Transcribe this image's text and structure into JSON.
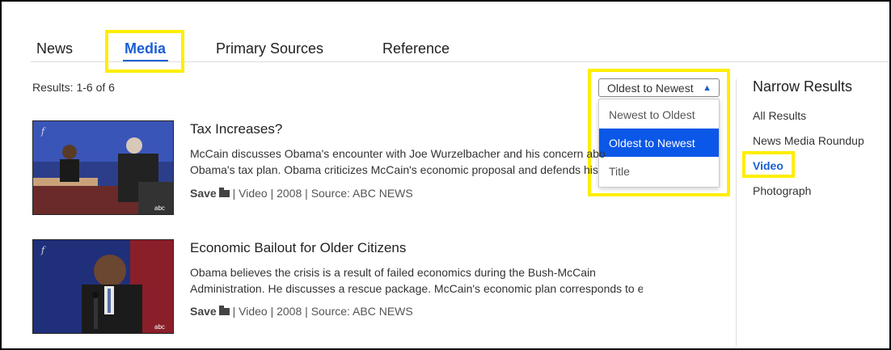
{
  "tabs": [
    {
      "label": "News"
    },
    {
      "label": "Media"
    },
    {
      "label": "Primary Sources"
    },
    {
      "label": "Reference"
    }
  ],
  "results_count": "Results: 1-6 of 6",
  "sort": {
    "selected": "Oldest to Newest",
    "options": [
      "Newest to Oldest",
      "Oldest to Newest",
      "Title"
    ]
  },
  "narrow": {
    "title": "Narrow Results",
    "facets": [
      "All Results",
      "News Media Roundup",
      "Video",
      "Photograph"
    ],
    "active": "Video"
  },
  "results": [
    {
      "title": "Tax Increases?",
      "desc_lines": [
        "McCain discusses Obama's encounter with Joe Wurzelbacher and his concern abo",
        "Obama's tax plan. Obama criticizes McCain's economic proposal and defends his"
      ],
      "save": "Save",
      "type": "Video",
      "year": "2008",
      "source": "Source: ABC NEWS",
      "thumb_logo": "abc"
    },
    {
      "title": "Economic Bailout for Older Citizens",
      "desc_lines": [
        "Obama believes the crisis is a result of failed economics during the Bush-McCain",
        "Administration. He discusses a rescue package. McCain's economic plan corresponds to en..."
      ],
      "save": "Save",
      "type": "Video",
      "year": "2008",
      "source": "Source: ABC NEWS",
      "thumb_logo": "abc"
    }
  ],
  "colors": {
    "accent": "#1a5fd6",
    "highlight": "#ffee00",
    "selected_option": "#0b57e8"
  }
}
